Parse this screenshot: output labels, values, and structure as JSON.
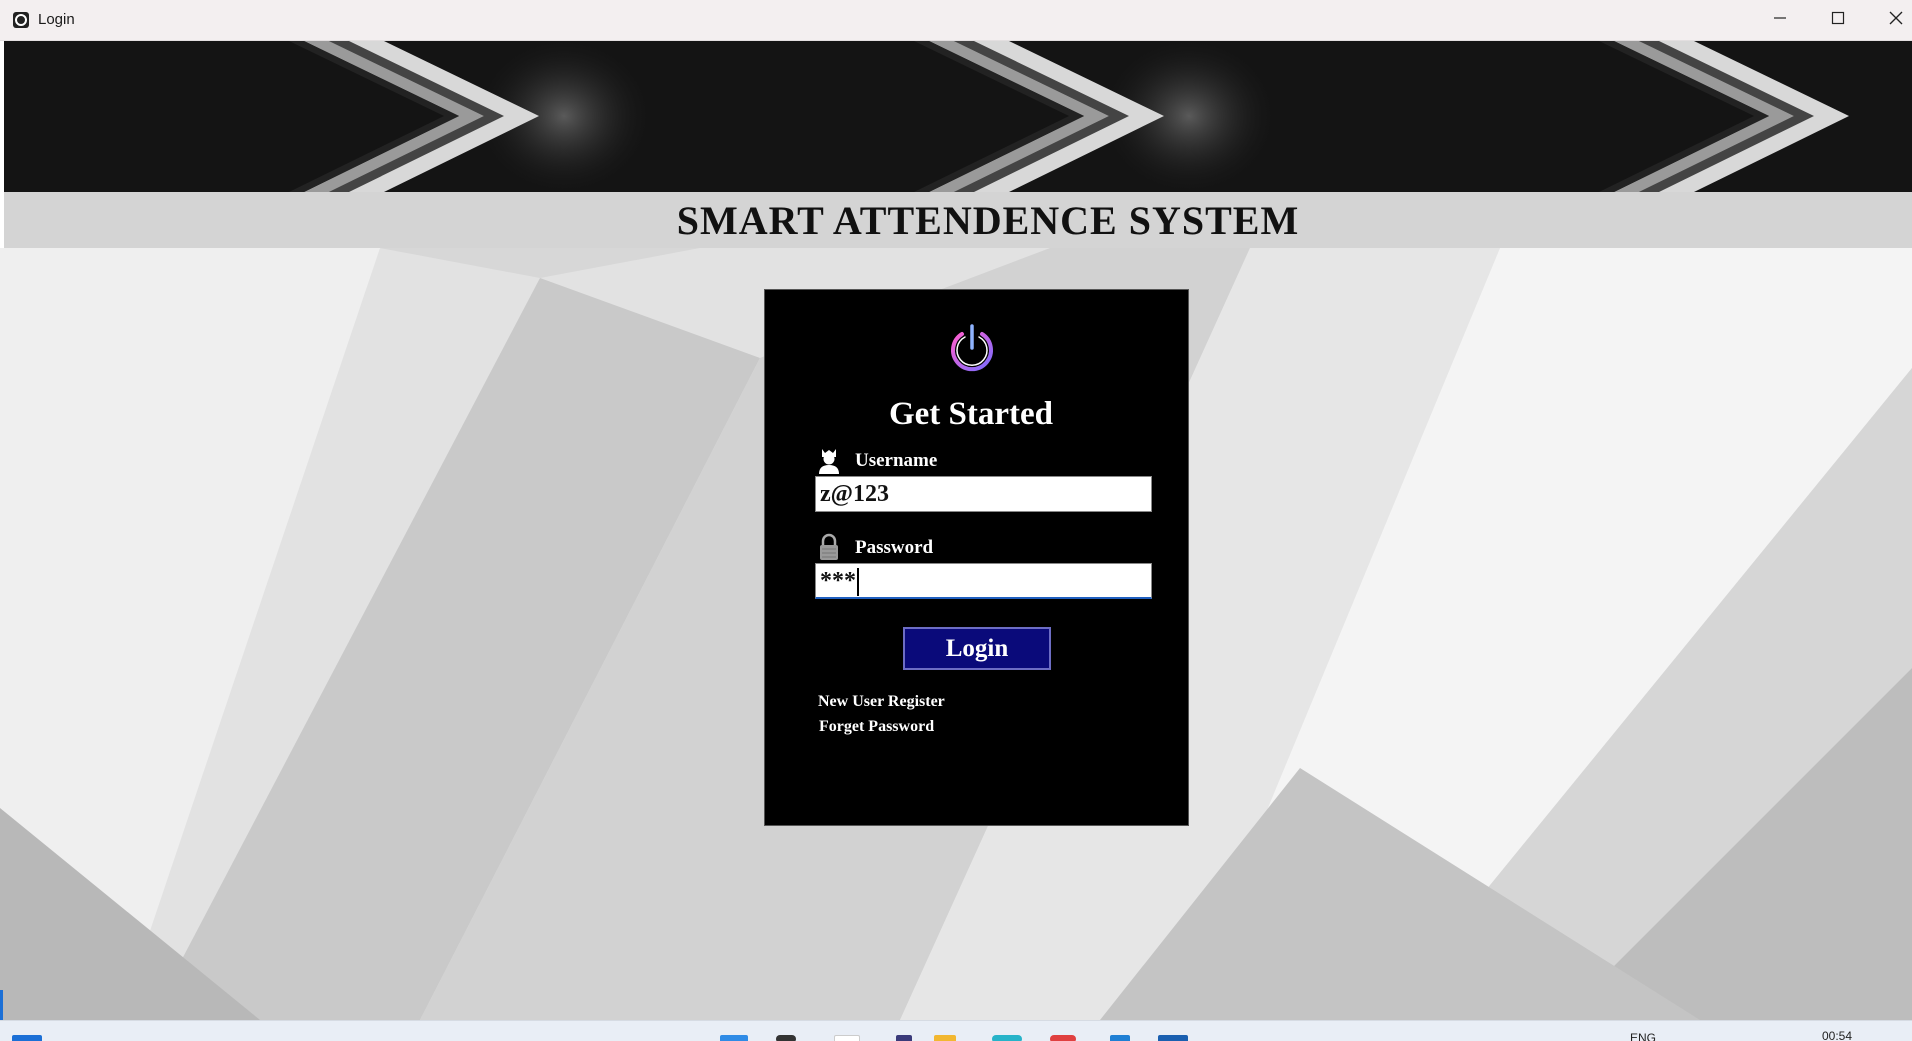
{
  "window": {
    "title": "Login",
    "icons": [
      "app-icon",
      "minimize-icon",
      "maximize-icon",
      "close-icon"
    ]
  },
  "header": {
    "heading": "SMART ATTENDENCE SYSTEM"
  },
  "login": {
    "icon": "power-icon",
    "title": "Get Started",
    "username_label": "Username",
    "username_value": "z@123",
    "password_label": "Password",
    "password_value": "***",
    "button_label": "Login",
    "register_link": "New User Register",
    "forget_link": "Forget Password"
  },
  "taskbar": {
    "language": "ENG",
    "time": "00:54"
  },
  "colors": {
    "card_background": "#000000",
    "button_background": "#0a0a7a",
    "header_strip": "#d4d4d4",
    "title_bar": "#f3eff0"
  }
}
